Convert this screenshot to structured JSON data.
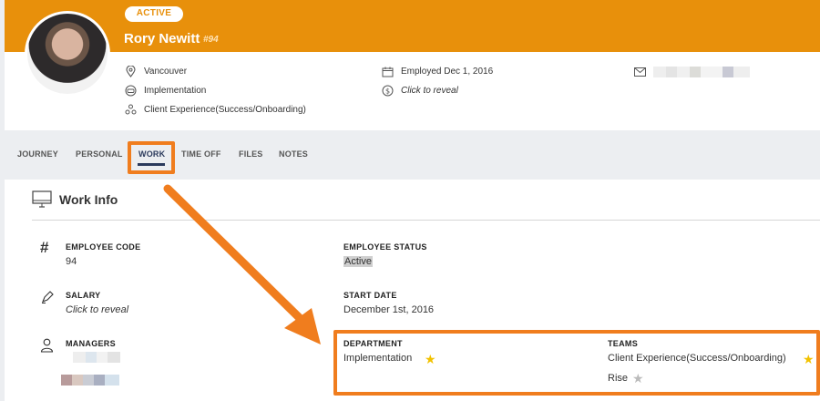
{
  "profile": {
    "status": "ACTIVE",
    "name": "Rory Newitt",
    "id": "#94",
    "location": "Vancouver",
    "department": "Implementation",
    "team": "Client Experience(Success/Onboarding)",
    "employed": "Employed Dec 1, 2016",
    "salary_reveal": "Click to reveal"
  },
  "tabs": [
    {
      "label": "JOURNEY"
    },
    {
      "label": "PERSONAL"
    },
    {
      "label": "WORK"
    },
    {
      "label": "TIME OFF"
    },
    {
      "label": "FILES"
    },
    {
      "label": "NOTES"
    }
  ],
  "work": {
    "title": "Work Info",
    "employee_code_label": "EMPLOYEE CODE",
    "employee_code_value": "94",
    "employee_status_label": "EMPLOYEE STATUS",
    "employee_status_value": "Active",
    "salary_label": "SALARY",
    "salary_value": "Click to reveal",
    "start_date_label": "START DATE",
    "start_date_value": "December 1st, 2016",
    "managers_label": "MANAGERS",
    "department_label": "DEPARTMENT",
    "department_value": "Implementation",
    "teams_label": "TEAMS",
    "teams": [
      "Client Experience(Success/Onboarding)",
      "Rise"
    ]
  },
  "colors": {
    "brand_orange": "#e8900b",
    "highlight": "#f07d1e",
    "active_tab": "#2b3a5c",
    "star_primary": "#f2c200",
    "star_inactive": "#bbbbbb"
  },
  "icons": {
    "location": "map-pin-icon",
    "department": "org-icon",
    "team": "team-icon",
    "calendar": "calendar-icon",
    "salary": "dollar-icon",
    "email": "envelope-icon",
    "work_info": "monitor-icon",
    "employee_code": "hash-icon",
    "salary_field": "pen-icon",
    "managers": "person-icon",
    "primary_star": "star-icon"
  }
}
